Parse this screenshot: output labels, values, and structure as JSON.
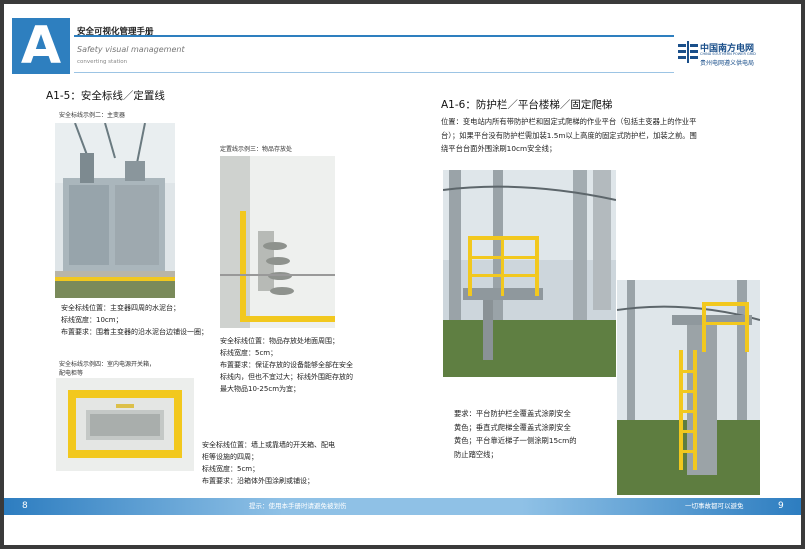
{
  "header": {
    "logo_letter": "A",
    "title": "安全可视化管理手册",
    "subtitle_en": "Safety visual management",
    "subtitle_en2": "converting station"
  },
  "brand": {
    "name_cn": "中国南方电网",
    "name_en": "CHINA SOUTHERN POWER GRID",
    "sub": "贵州电网遵义供电局",
    "color": "#1a4f8a"
  },
  "left": {
    "section_title": "A1-5：安全标线／定置线",
    "example2": {
      "caption": "安全标线示例二：主变器",
      "lines": [
        "安全标线位置：主变器四周的水泥台；",
        "标线宽度：10cm；",
        "布置要求：围着主变器的沿水泥台边铺设一圈；"
      ]
    },
    "example3": {
      "caption": "定置线示例三：物品存放处",
      "lines": [
        "安全标线位置：物品存放处地面周围；",
        "标线宽度：5cm；",
        "布置要求：保证存放的设备能够全部在安全",
        "标线内，但也不宜过大；标线外围距存放的",
        "最大物品10-25cm为宜；"
      ]
    },
    "example4": {
      "caption_lines": [
        "安全标线示例四：室内电源开关箱，",
        "配电柜等"
      ],
      "lines": [
        "安全标线位置：墙上或靠墙的开关箱、配电",
        "柜等设施的四周；",
        "标线宽度：5cm；",
        "布置要求：沿箱体外围涂刷或铺设；"
      ]
    }
  },
  "right": {
    "section_title": "A1-6：防护栏／平台楼梯／固定爬梯",
    "intro_lines": [
      "位置：变电站内所有带防护栏和固定式爬梯的作业平台（包括主变器上的作业平",
      "台）；如果平台没有防护栏需加装1.5m以上高度的固定式防护栏，加装之前。围",
      "绕平台台面外围涂刷10cm安全线；"
    ],
    "req_lines": [
      "要求：平台防护栏全覆盖式涂刷安全",
      "黄色；垂直式爬梯全覆盖式涂刷安全",
      "黄色；平台靠近梯子一侧涂刷15cm的",
      "防止踏空线；"
    ]
  },
  "footer": {
    "page_left": "8",
    "page_right": "9",
    "tip": "提示：使用本手册时请避免被划伤",
    "slogan": "一切事故都可以避免"
  },
  "colors": {
    "accent": "#2e7fbf",
    "safety_yellow": "#f2c81e"
  }
}
